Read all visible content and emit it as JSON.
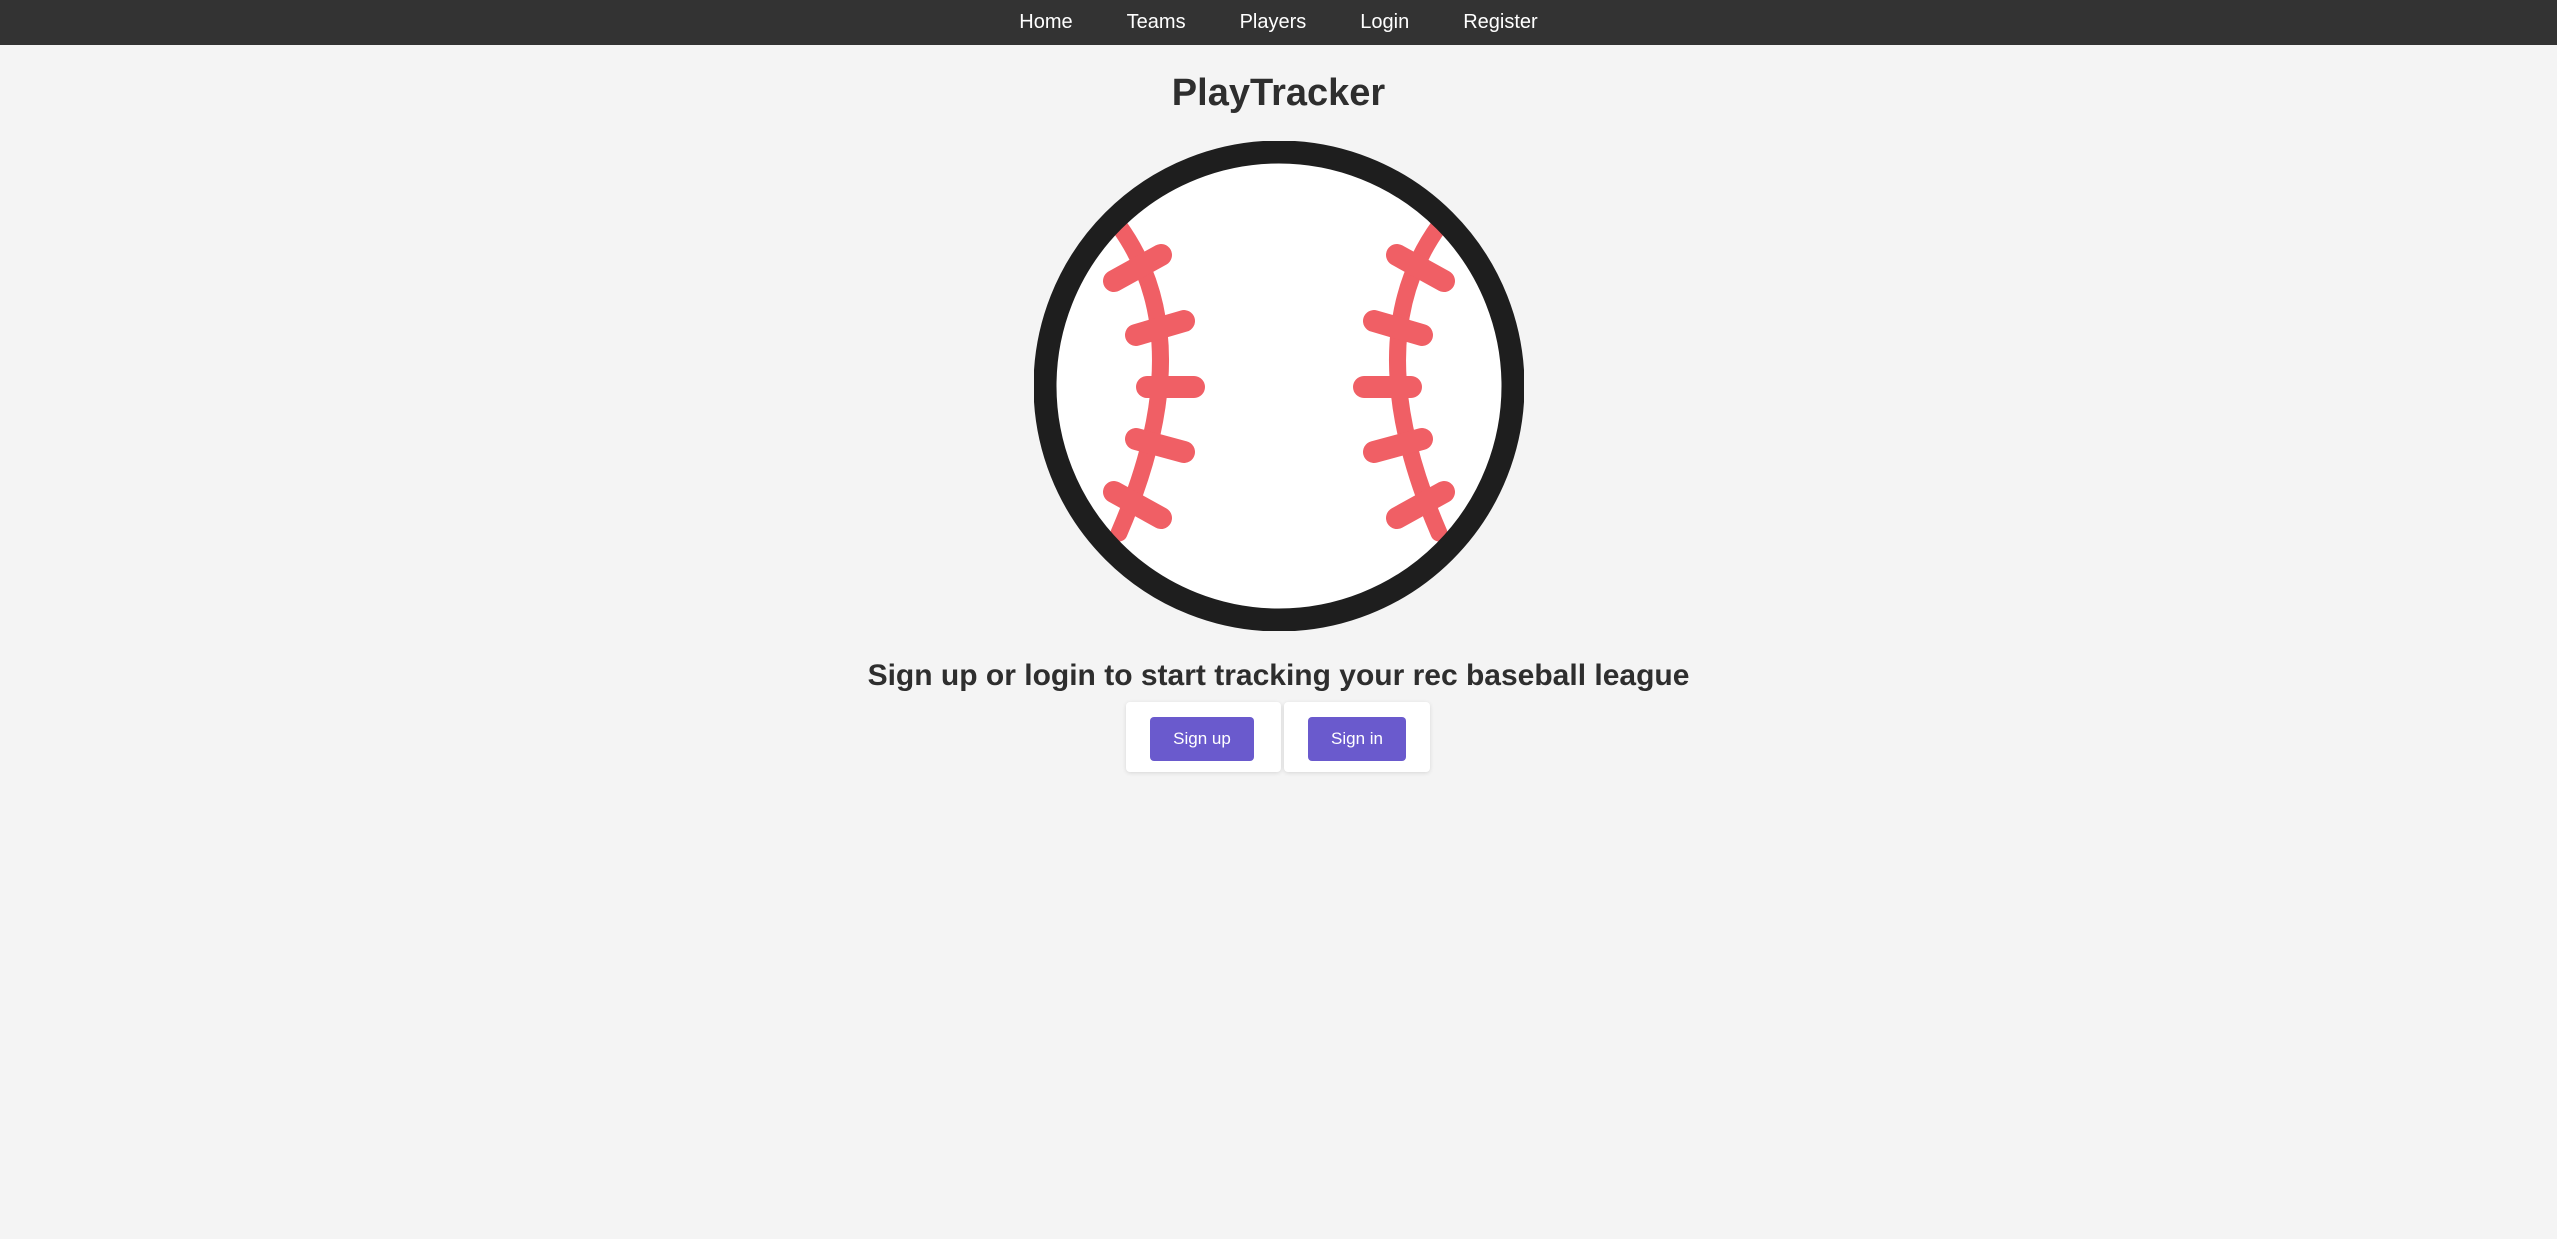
{
  "nav": {
    "items": [
      {
        "label": "Home"
      },
      {
        "label": "Teams"
      },
      {
        "label": "Players"
      },
      {
        "label": "Login"
      },
      {
        "label": "Register"
      }
    ]
  },
  "main": {
    "title": "PlayTracker",
    "logo_icon": "baseball-icon",
    "tagline": "Sign up or login to start tracking your rec baseball league",
    "signup_label": "Sign up",
    "signin_label": "Sign in"
  },
  "colors": {
    "navbar": "#333333",
    "background": "#f4f4f4",
    "button": "#6a5acd",
    "ball_outline": "#1e1e1e",
    "ball_stitches": "#f05f65"
  }
}
